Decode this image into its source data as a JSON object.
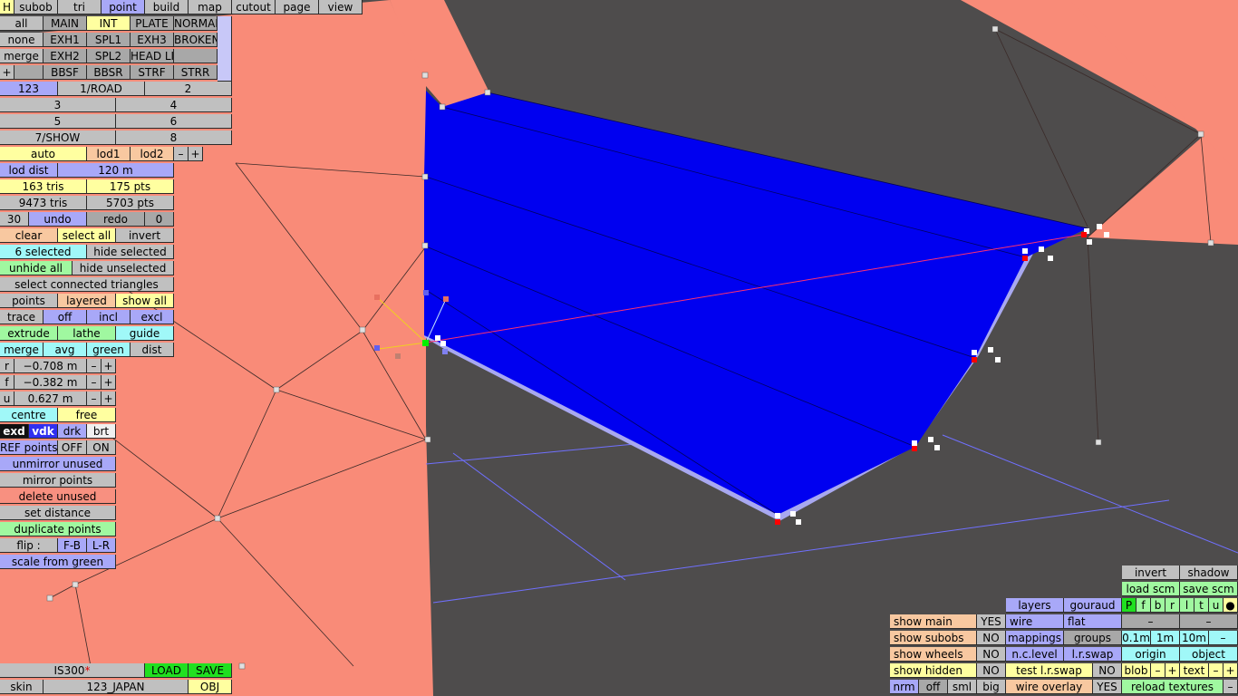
{
  "colors": {
    "background": "#4e4c4c",
    "mesh_salmon": "#f98b78",
    "selection_blue": "#0000f0",
    "selection_edges": "#a8a8f0",
    "guide_line": "#7070ff",
    "red_line": "#ff3070"
  },
  "tabs": [
    "H",
    "subob",
    "tri",
    "point",
    "build",
    "map",
    "cutout",
    "page",
    "view"
  ],
  "groups": {
    "row1": [
      "all",
      "MAIN",
      "INT",
      "PLATE",
      "NORMAL"
    ],
    "row2": [
      "none",
      "EXH1",
      "SPL1",
      "EXH3",
      "BROKEN"
    ],
    "row3": [
      "merge",
      "EXH2",
      "SPL2",
      "HEAD LI",
      ""
    ],
    "row4": [
      "+",
      "",
      "BBSF",
      "BBSR",
      "STRF",
      "STRR"
    ]
  },
  "layers": {
    "row1": [
      "123",
      "1/ROAD",
      "2"
    ],
    "row2": [
      "3",
      "4"
    ],
    "row3": [
      "5",
      "6"
    ],
    "row4": [
      "7/SHOW",
      "8"
    ]
  },
  "lod": {
    "auto": "auto",
    "lod1": "lod1",
    "lod2": "lod2",
    "minus": "–",
    "plus": "+",
    "dist_label": "lod dist",
    "dist_value": "120 m"
  },
  "stats": {
    "tris": "163 tris",
    "pts": "175 pts",
    "total_tris": "9473 tris",
    "total_pts": "5703 pts"
  },
  "undo": {
    "count": "30",
    "undo": "undo",
    "redo": "redo",
    "redo_count": "0"
  },
  "selection": {
    "clear": "clear",
    "select_all": "select all",
    "invert": "invert",
    "selected": "6 selected",
    "hide_selected": "hide selected",
    "unhide_all": "unhide all",
    "hide_unselected": "hide unselected",
    "select_connected": "select connected triangles"
  },
  "display": {
    "points": "points",
    "layered": "layered",
    "show_all": "show all"
  },
  "trace": {
    "label": "trace",
    "off": "off",
    "incl": "incl",
    "excl": "excl"
  },
  "tools": {
    "extrude": "extrude",
    "lathe": "lathe",
    "guide": "guide",
    "merge": "merge",
    "avg": "avg",
    "green": "green",
    "dist": "dist"
  },
  "coords": [
    {
      "axis": "r",
      "value": "−0.708 m"
    },
    {
      "axis": "f",
      "value": "−0.382 m"
    },
    {
      "axis": "u",
      "value": "0.627 m"
    }
  ],
  "centre": {
    "centre": "centre",
    "free": "free"
  },
  "mode": {
    "exd": "exd",
    "vdk": "vdk",
    "drk": "drk",
    "brt": "brt"
  },
  "ref_points": {
    "label": "REF points",
    "off": "OFF",
    "on": "ON"
  },
  "ops": {
    "unmirror": "unmirror unused",
    "mirror": "mirror points",
    "delete": "delete unused",
    "set_distance": "set distance",
    "duplicate": "duplicate points",
    "flip": "flip :",
    "fb": "F-B",
    "lr": "L-R",
    "scale": "scale from green"
  },
  "bottom_left": {
    "model": "IS300",
    "modified": "*",
    "load": "LOAD",
    "save": "SAVE",
    "skin": "skin",
    "skin_value": "123_JAPAN",
    "obj": "OBJ"
  },
  "show": {
    "main": "show main",
    "main_v": "YES",
    "subobs": "show subobs",
    "subobs_v": "NO",
    "wheels": "show wheels",
    "wheels_v": "NO",
    "hidden": "show hidden",
    "hidden_v": "NO"
  },
  "view_opts": {
    "nrm": "nrm",
    "off": "off",
    "sml": "sml",
    "big": "big"
  },
  "render": {
    "layers": "layers",
    "gouraud": "gouraud",
    "wire": "wire",
    "flat": "flat",
    "mappings": "mappings",
    "groups": "groups",
    "nc_level": "n.c.level",
    "lr_swap": "l.r.swap",
    "test_lr_swap": "test l.r.swap",
    "test_v": "NO",
    "wire_overlay": "wire overlay",
    "wire_overlay_v": "YES"
  },
  "right": {
    "invert": "invert",
    "shadow": "shadow",
    "load_scm": "load scm",
    "save_scm": "save scm",
    "flags": [
      "P",
      "f",
      "b",
      "r",
      "l",
      "t",
      "u",
      "●"
    ],
    "dash1": "–",
    "dash2": "–",
    "d01": "0.1m",
    "d1": "1m",
    "d10": "10m",
    "dm": "–",
    "origin": "origin",
    "object": "object",
    "blob": "blob",
    "text": "text",
    "minus": "–",
    "plus": "+",
    "reload": "reload textures"
  }
}
